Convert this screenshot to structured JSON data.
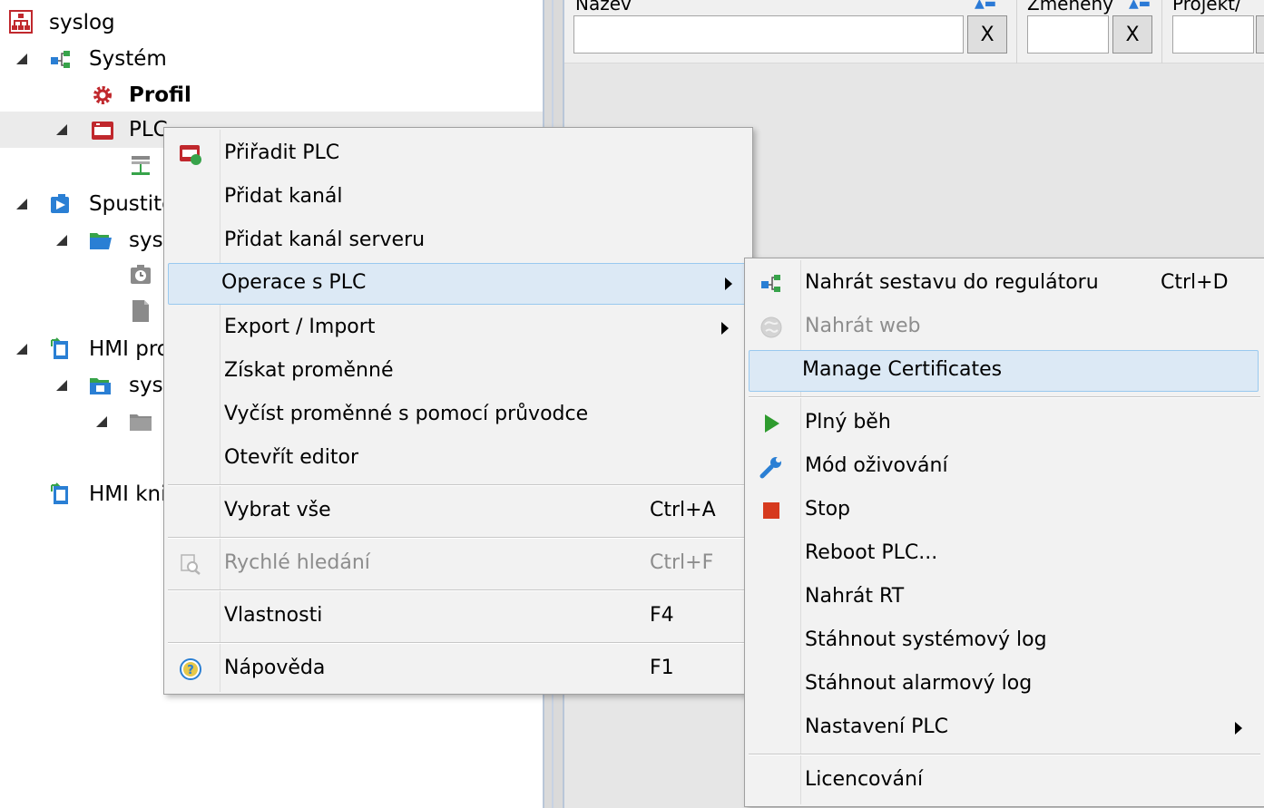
{
  "tree": {
    "root": "syslog",
    "system": "Systém",
    "profil": "Profil",
    "plc": "PLC",
    "spustitelne": "Spustite",
    "syslog_child1": "sysl",
    "hmi_projekt": "HMI pro",
    "syslog_child2": "sysl",
    "hmi_knihovna": "HMI kni"
  },
  "filters": {
    "col1_header": "Název",
    "col2_header": "Změněny",
    "col3_header": "Projekt/",
    "clear_label": "X"
  },
  "context_menu": {
    "items": [
      {
        "label": "Přiřadit PLC",
        "icon": "assign-plc-icon"
      },
      {
        "label": "Přidat kanál"
      },
      {
        "label": "Přidat kanál serveru"
      },
      {
        "label": "Operace s PLC",
        "submenu": true
      },
      {
        "label": "Export / Import",
        "submenu": true
      },
      {
        "label": "Získat proměnné"
      },
      {
        "label": "Vyčíst proměnné s pomocí průvodce"
      },
      {
        "label": "Otevřít editor"
      },
      {
        "label": "Vybrat vše",
        "shortcut": "Ctrl+A"
      },
      {
        "label": "Rychlé hledání",
        "shortcut": "Ctrl+F",
        "disabled": true,
        "icon": "quick-search-icon"
      },
      {
        "label": "Vlastnosti",
        "shortcut": "F4"
      },
      {
        "label": "Nápověda",
        "shortcut": "F1",
        "icon": "help-icon"
      }
    ]
  },
  "submenu": {
    "items": [
      {
        "label": "Nahrát sestavu do regulátoru",
        "shortcut": "Ctrl+D",
        "icon": "upload-config-icon"
      },
      {
        "label": "Nahrát web",
        "disabled": true,
        "icon": "web-icon"
      },
      {
        "label": "Manage Certificates"
      },
      {
        "label": "Plný běh",
        "icon": "play-icon"
      },
      {
        "label": "Mód oživování",
        "icon": "wrench-icon"
      },
      {
        "label": "Stop",
        "icon": "stop-icon"
      },
      {
        "label": "Reboot PLC..."
      },
      {
        "label": "Nahrát RT"
      },
      {
        "label": "Stáhnout systémový log"
      },
      {
        "label": "Stáhnout alarmový log"
      },
      {
        "label": "Nastavení PLC",
        "submenu": true
      },
      {
        "label": "Licencování"
      }
    ]
  },
  "colors": {
    "highlight_bg": "#dce9f5",
    "highlight_border": "#99c9ef",
    "accent_red": "#c0282d",
    "play_green": "#2e9b2e",
    "stop_red": "#d63a1e"
  }
}
